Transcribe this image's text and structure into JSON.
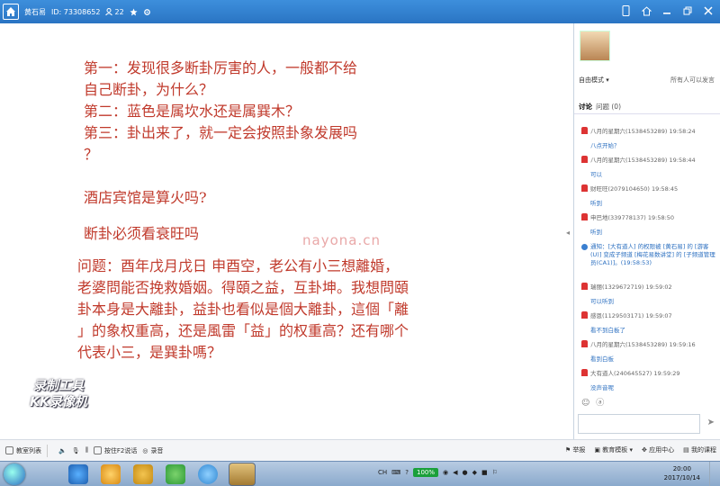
{
  "titlebar": {
    "room_name": "黄石易",
    "room_id": "ID: 73308652",
    "member_count": "22",
    "icons": [
      "home-icon",
      "user-icon",
      "star-icon",
      "settings-icon",
      "phone-icon",
      "skin-icon",
      "minimize-icon",
      "restore-icon",
      "close-icon"
    ]
  },
  "board": {
    "questions": [
      "第一：发现很多断卦厉害的人，一般都不给",
      "自己断卦，为什么？",
      "第二：蓝色是属坎水还是属巽木？",
      "第三：卦出来了，就一定会按照卦象发展吗",
      "？"
    ],
    "hotel": "酒店宾馆是算火吗?",
    "duangua": "断卦必须看衰旺吗",
    "paragraph": [
      "问题：酉年戊月戊日 申酉空，老公有小三想離婚，",
      "老婆問能否挽救婚姻。得頤之益，互卦坤。我想問頤",
      "卦本身是大離卦，益卦也看似是個大離卦，這個「離",
      "」的象权重高，还是風雷「益」的权重高？还有哪个",
      "代表小三，是巽卦嗎？"
    ],
    "watermark": "nayona.cn",
    "record_badge_line1": "录制工具",
    "record_badge_line2": "KK录像机"
  },
  "panel": {
    "mode": "自由模式 ▾",
    "all_ask": "所有人可以发言",
    "tab_discuss": "讨论",
    "tab_question": "问题 (0)",
    "chat": [
      {
        "meta": "八月的星期六(1538453289) 19:58:24",
        "text": "八点开始？"
      },
      {
        "meta": "八月的星期六(1538453289) 19:58:44",
        "text": "可以"
      },
      {
        "meta": "财旺旺(2079104650) 19:58:45",
        "text": "听到"
      },
      {
        "meta": "申巴地(339778137) 19:58:50",
        "text": "听到"
      }
    ],
    "notice": "通知：[大有道人] 的权限被 [黄石易] 的 [游客(U)] 变成子频道 [梅花易数讲堂] 的 [子频道管理员(CA1)]。(19:58:53)",
    "chat2": [
      {
        "meta": "瑞丽(1329672719) 19:59:02",
        "text": "可以听到"
      },
      {
        "meta": "感恩(1129503171) 19:59:07",
        "text": "看不到白板了"
      },
      {
        "meta": "八月的星期六(1538453289) 19:59:16",
        "text": "看到白板"
      },
      {
        "meta": "大有道人(240645527) 19:59:29",
        "text": "没声音呢"
      }
    ]
  },
  "toolbar": {
    "left": [
      "教室列表"
    ],
    "push_to_talk": "按住F2说话",
    "record": "录音",
    "right": [
      "举报",
      "教育模板 ▾",
      "应用中心",
      "我的课程"
    ]
  },
  "taskbar": {
    "tray_lang": "CH",
    "battery": "100%",
    "time": "20:00",
    "date": "2017/10/14"
  }
}
